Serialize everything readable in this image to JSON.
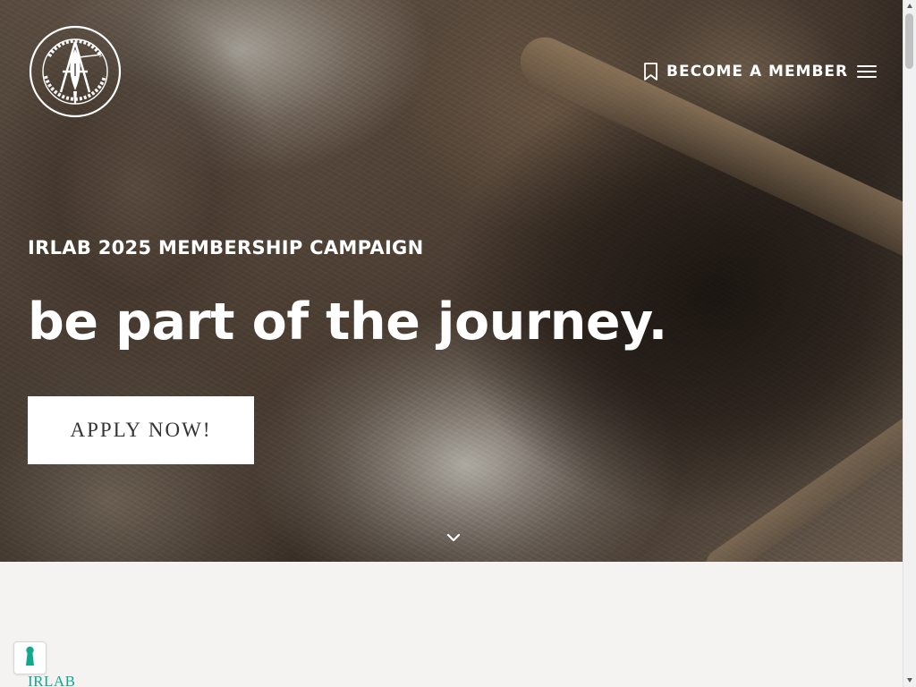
{
  "header": {
    "logo_icon": "irlab-logo-icon",
    "member_label": "BECOME A MEMBER",
    "member_icon": "bookmark-icon",
    "menu_icon": "hamburger-menu-icon"
  },
  "hero": {
    "eyebrow": "IRLAB 2025 MEMBERSHIP CAMPAIGN",
    "headline": "be part of the journey.",
    "apply_label": "APPLY NOW!",
    "scroll_icon": "chevron-down-icon"
  },
  "content": {
    "section_label": "IRLAB"
  },
  "privacy": {
    "icon": "keyhole-icon"
  },
  "colors": {
    "text_on_image": "#ffffff",
    "button_bg": "#ffffff",
    "section_accent": "#0fa88f",
    "page_background": "#f4f3f2"
  }
}
